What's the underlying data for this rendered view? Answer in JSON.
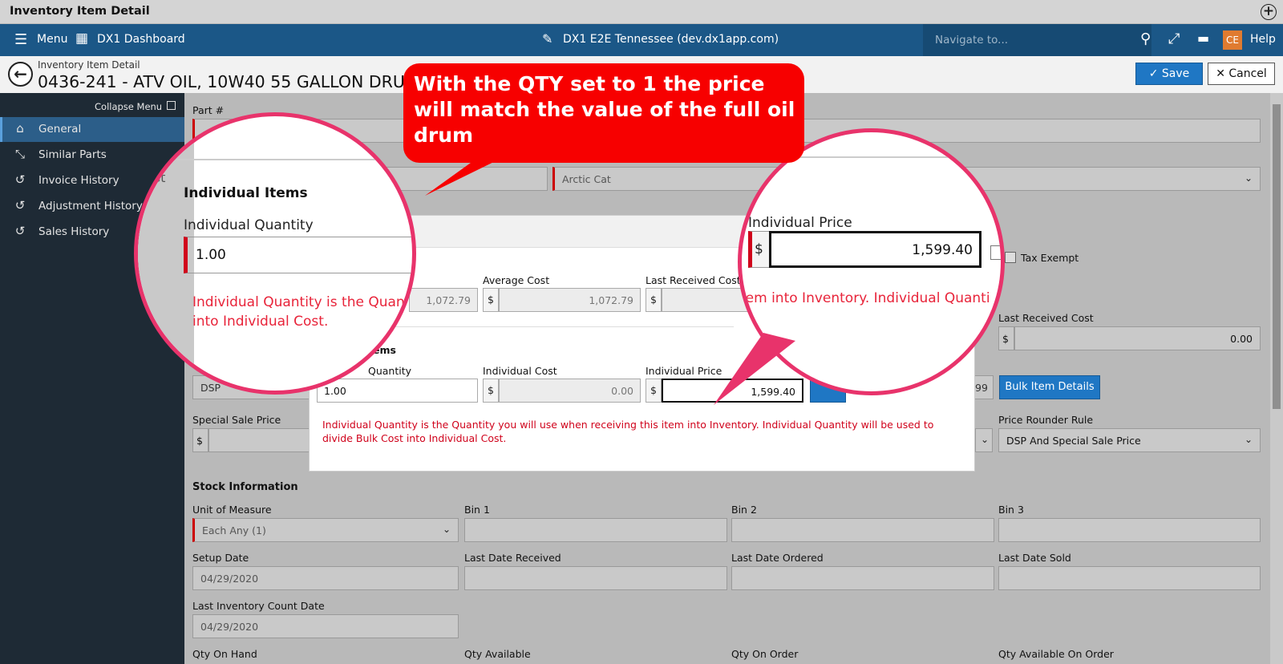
{
  "window": {
    "title": "Inventory Item Detail"
  },
  "navbar": {
    "menu": "Menu",
    "dashboard": "DX1 Dashboard",
    "site": "DX1 E2E Tennessee (dev.dx1app.com)",
    "search_placeholder": "Navigate to...",
    "user_initials": "CE",
    "help": "Help"
  },
  "header": {
    "subtitle": "Inventory Item Detail",
    "title": "0436-241 - ATV OIL, 10W40 55 GALLON DRUM",
    "save": "Save",
    "cancel": "Cancel"
  },
  "sidebar": {
    "collapse": "Collapse Menu",
    "items": [
      {
        "label": "General",
        "icon": "home-icon"
      },
      {
        "label": "Similar Parts",
        "icon": "compress-arrows-icon"
      },
      {
        "label": "Invoice History",
        "icon": "history-icon"
      },
      {
        "label": "Adjustment History",
        "icon": "history-icon"
      },
      {
        "label": "Sales History",
        "icon": "history-icon"
      }
    ]
  },
  "form": {
    "part_label": "Part #",
    "manufacturer_value": "Arctic Cat",
    "tax_exempt": "Tax Exempt",
    "last_received_cost_label": "Last Received Cost",
    "last_received_cost_value": "0.00",
    "bulk_item_details": "Bulk Item Details",
    "dsp_value": "DSP",
    "dsp_partial": "99",
    "special_sale_price_label": "Special Sale Price",
    "price_rounder_rule_label": "Price Rounder Rule",
    "price_rounder_rule_value": "DSP And Special Sale Price",
    "stock_information": "Stock Information",
    "unit_of_measure_label": "Unit of Measure",
    "unit_of_measure_value": "Each Any (1)",
    "bin1": "Bin 1",
    "bin2": "Bin 2",
    "bin3": "Bin 3",
    "setup_date_label": "Setup Date",
    "setup_date_value": "04/29/2020",
    "last_date_received": "Last Date Received",
    "last_date_ordered": "Last Date Ordered",
    "last_date_sold": "Last Date Sold",
    "last_inventory_count_date_label": "Last Inventory Count Date",
    "last_inventory_count_date_value": "04/29/2020",
    "qty_on_hand": "Qty On Hand",
    "qty_available": "Qty Available",
    "qty_on_order": "Qty On Order",
    "qty_available_on_order": "Qty Available On Order"
  },
  "modal": {
    "bulk_cost_value": "1,072.79",
    "average_cost_label": "Average Cost",
    "average_cost_value": "1,072.79",
    "last_received_cost_label": "Last Received Cost",
    "section_partial": "ems",
    "individual_quantity_partial": "Quantity",
    "individual_quantity_value": "1.00",
    "individual_cost_label": "Individual Cost",
    "individual_cost_value": "0.00",
    "individual_price_label": "Individual Price",
    "individual_price_value": "1,599.40",
    "currency": "$",
    "warning": "Individual Quantity is the Quantity you will use when receiving this item into Inventory. Individual Quantity will be used to divide Bulk Cost into Individual Cost."
  },
  "callout": {
    "text": "With the QTY set to 1 the price will match the value of the full oil drum"
  },
  "magnifier_left": {
    "cost_partial": "ost",
    "section": "Individual Items",
    "quantity_label": "Individual Quantity",
    "quantity_value": "1.00",
    "warning_line1": "Individual Quantity is the Quan",
    "warning_line2": "into Individual Cost."
  },
  "magnifier_right": {
    "price_label": "Individual Price",
    "currency": "$",
    "price_value": "1,599.40",
    "warning_partial": "tem into Inventory. Individual Quanti"
  }
}
